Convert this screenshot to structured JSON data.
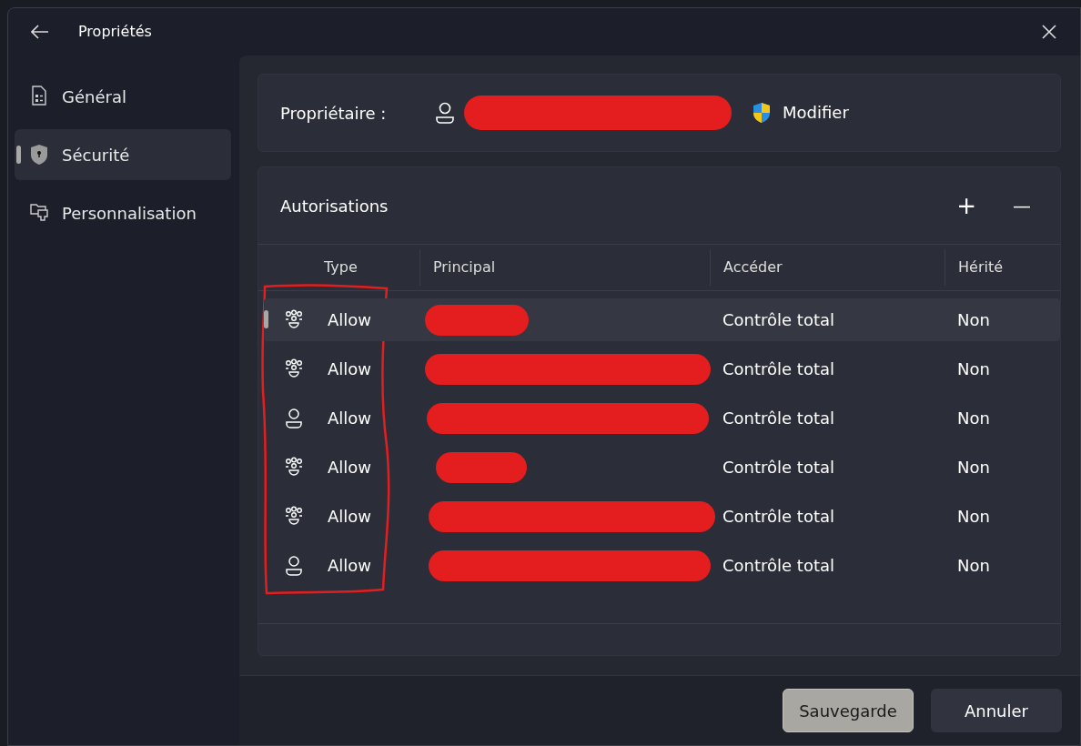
{
  "window": {
    "title": "Propriétés"
  },
  "sidebar": {
    "items": [
      {
        "label": "Général",
        "kind": "document",
        "selected": false
      },
      {
        "label": "Sécurité",
        "kind": "shield",
        "selected": true
      },
      {
        "label": "Personnalisation",
        "kind": "folder",
        "selected": false
      }
    ]
  },
  "owner": {
    "label": "Propriétaire :",
    "action": "Modifier"
  },
  "permissions": {
    "title": "Autorisations",
    "add": "+",
    "remove": "—",
    "columns": [
      "Type",
      "Principal",
      "Accéder",
      "Hérité"
    ],
    "rows": [
      {
        "kind": "group",
        "type": "Allow",
        "access": "Contrôle total",
        "inherited": "Non",
        "selected": true
      },
      {
        "kind": "group",
        "type": "Allow",
        "access": "Contrôle total",
        "inherited": "Non",
        "selected": false
      },
      {
        "kind": "user",
        "type": "Allow",
        "access": "Contrôle total",
        "inherited": "Non",
        "selected": false
      },
      {
        "kind": "group",
        "type": "Allow",
        "access": "Contrôle total",
        "inherited": "Non",
        "selected": false
      },
      {
        "kind": "group",
        "type": "Allow",
        "access": "Contrôle total",
        "inherited": "Non",
        "selected": false
      },
      {
        "kind": "user",
        "type": "Allow",
        "access": "Contrôle total",
        "inherited": "Non",
        "selected": false
      }
    ]
  },
  "buttons": [
    {
      "label": "Sauvegarde",
      "kind": "primary"
    },
    {
      "label": "Annuler",
      "kind": "secondary"
    }
  ]
}
